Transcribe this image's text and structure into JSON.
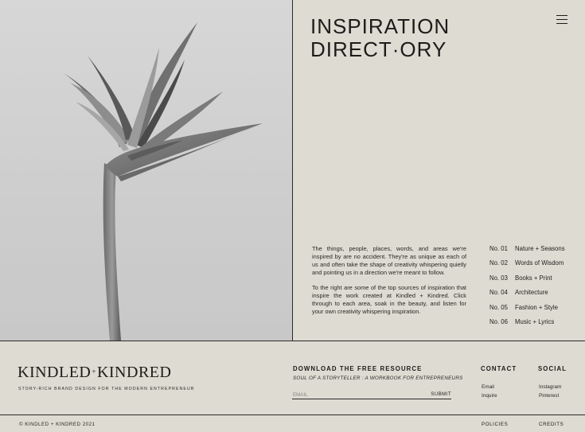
{
  "header": {
    "title_line1": "INSPIRATION",
    "title_line2": "DIRECT·ORY",
    "menu_icon": "hamburger-menu-icon"
  },
  "intro": {
    "paragraph1": "The things, people, places, words, and areas we're inspired by are no accident. They're as unique as each of us and often take the shape of creativity whispering quietly and pointing us in a direction we're meant to follow.",
    "paragraph2": "To the right are some of the top sources of inspiration that inspire the work created at Kindled + Kindred. Click through to each area, soak in the beauty, and listen for your own creativity whispering inspiration."
  },
  "directory": [
    {
      "num": "No. 01",
      "label": "Nature + Seasons"
    },
    {
      "num": "No. 02",
      "label": "Words of Wisdom"
    },
    {
      "num": "No. 03",
      "label": "Books + Print"
    },
    {
      "num": "No. 04",
      "label": "Architecture"
    },
    {
      "num": "No. 05",
      "label": "Fashion + Style"
    },
    {
      "num": "No. 06",
      "label": "Music + Lyrics"
    }
  ],
  "footer": {
    "brand_left": "KINDLED",
    "brand_plus": "+",
    "brand_right": "KINDRED",
    "tagline": "STORY-RICH BRAND DESIGN FOR THE MODERN ENTREPRENEUR",
    "download_heading": "DOWNLOAD THE FREE RESOURCE",
    "download_sub": "SOUL OF A STORYTELLER : A WORKBOOK FOR ENTREPRENEURS",
    "email_placeholder": "EMAIL",
    "submit_label": "SUBMIT",
    "contact_heading": "CONTACT",
    "contact_links": [
      "Email",
      "Inquire"
    ],
    "social_heading": "SOCIAL",
    "social_links": [
      "Instagram",
      "Pinterest"
    ],
    "copyright": "© KINDLED + KINDRED 2021",
    "policies": "POLICIES",
    "credits": "CREDITS"
  },
  "colors": {
    "background": "#dedbd2",
    "text": "#1d1c1a",
    "photo_bg": "#d2d2d2"
  }
}
